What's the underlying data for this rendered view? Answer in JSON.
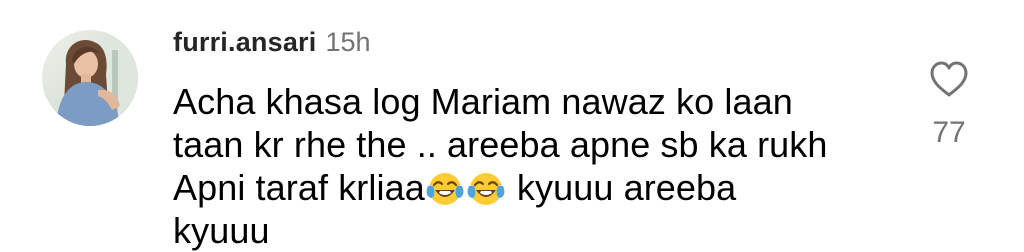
{
  "comment": {
    "username": "furri.ansari",
    "timestamp": "15h",
    "text_lines": [
      "Acha khasa log Mariam nawaz ko laan",
      "taan kr rhe the .. areeba apne sb ka rukh",
      "Apni taraf krliaa",
      " kyuuu areeba",
      "kyuuu"
    ],
    "emojis": [
      "face-with-tears-of-joy-icon",
      "face-with-tears-of-joy-icon"
    ],
    "like_count": "77"
  },
  "icons": {
    "like": "heart-outline-icon",
    "avatar": "profile-photo"
  },
  "colors": {
    "username": "#262626",
    "secondary_text": "#737373",
    "body_text": "#000000",
    "emoji_face": "#FFCC33",
    "emoji_tears": "#4FA3E0"
  }
}
